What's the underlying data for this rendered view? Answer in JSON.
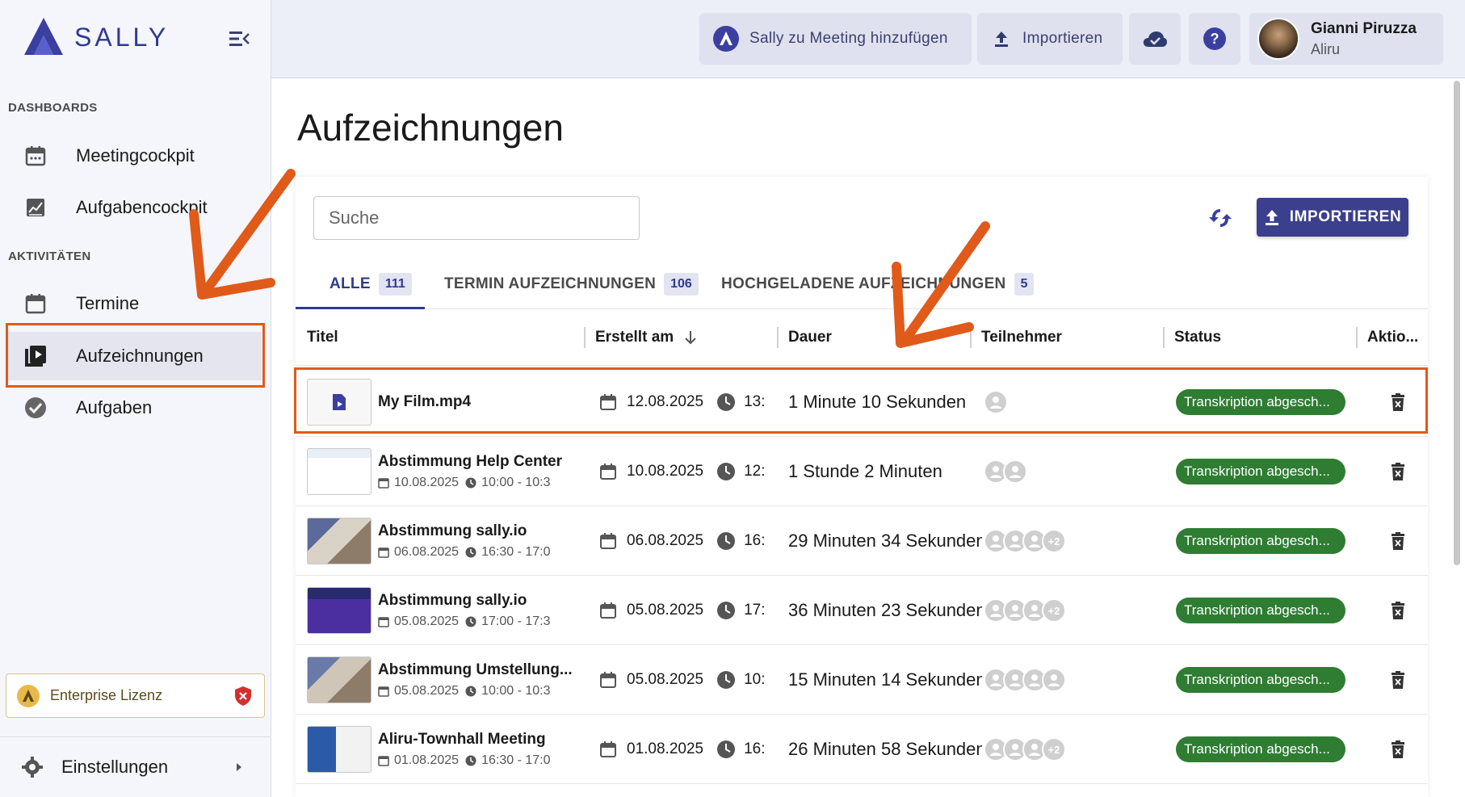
{
  "app": {
    "logo_text": "SALLY"
  },
  "sidebar": {
    "sections": [
      {
        "label": "DASHBOARDS"
      },
      {
        "label": "AKTIVITÄTEN"
      }
    ],
    "items": [
      {
        "label": "Meetingcockpit",
        "icon": "calendar-icon"
      },
      {
        "label": "Aufgabencockpit",
        "icon": "chart-icon"
      },
      {
        "label": "Termine",
        "icon": "calendar-icon"
      },
      {
        "label": "Aufzeichnungen",
        "icon": "video-library-icon"
      },
      {
        "label": "Aufgaben",
        "icon": "check-circle-icon"
      }
    ],
    "license_label": "Enterprise Lizenz",
    "settings_label": "Einstellungen"
  },
  "topbar": {
    "add_meeting_label": "Sally zu Meeting hinzufügen",
    "import_label": "Importieren",
    "user_name": "Gianni Piruzza",
    "user_org": "Aliru"
  },
  "main": {
    "title": "Aufzeichnungen",
    "search_placeholder": "Suche",
    "import_button": "IMPORTIEREN",
    "tabs": [
      {
        "label": "ALLE",
        "count": "111"
      },
      {
        "label": "TERMIN AUFZEICHNUNGEN",
        "count": "106"
      },
      {
        "label": "HOCHGELADENE AUFZEICHNUNGEN",
        "count": "5"
      }
    ],
    "columns": [
      "Titel",
      "Erstellt am",
      "Dauer",
      "Teilnehmer",
      "Status",
      "Aktio..."
    ],
    "rows": [
      {
        "title": "My Film.mp4",
        "sub_date": "",
        "sub_time": "",
        "date": "12.08.2025",
        "time": "13:",
        "duration": "1 Minute 10 Sekunden",
        "participants": 1,
        "more": "",
        "status": "Transkription abgesch..."
      },
      {
        "title": "Abstimmung Help Center",
        "sub_date": "10.08.2025",
        "sub_time": "10:00 - 10:3",
        "date": "10.08.2025",
        "time": "12:",
        "duration": "1 Stunde 2 Minuten",
        "participants": 2,
        "more": "",
        "status": "Transkription abgesch..."
      },
      {
        "title": "Abstimmung sally.io",
        "sub_date": "06.08.2025",
        "sub_time": "16:30 - 17:0",
        "date": "06.08.2025",
        "time": "16:",
        "duration": "29 Minuten 34 Sekunden",
        "participants": 3,
        "more": "+2",
        "status": "Transkription abgesch..."
      },
      {
        "title": "Abstimmung sally.io",
        "sub_date": "05.08.2025",
        "sub_time": "17:00 - 17:3",
        "date": "05.08.2025",
        "time": "17:",
        "duration": "36 Minuten 23 Sekunden",
        "participants": 3,
        "more": "+2",
        "status": "Transkription abgesch..."
      },
      {
        "title": "Abstimmung Umstellung...",
        "sub_date": "05.08.2025",
        "sub_time": "10:00 - 10:3",
        "date": "05.08.2025",
        "time": "10:",
        "duration": "15 Minuten 14 Sekunden",
        "participants": 4,
        "more": "",
        "status": "Transkription abgesch..."
      },
      {
        "title": "Aliru-Townhall Meeting",
        "sub_date": "01.08.2025",
        "sub_time": "16:30 - 17:0",
        "date": "01.08.2025",
        "time": "16:",
        "duration": "26 Minuten 58 Sekunden",
        "participants": 3,
        "more": "+2",
        "status": "Transkription abgesch..."
      }
    ]
  },
  "colors": {
    "accent": "#2f3a8f",
    "status_green": "#2e7d32",
    "highlight": "#e05a1a"
  }
}
